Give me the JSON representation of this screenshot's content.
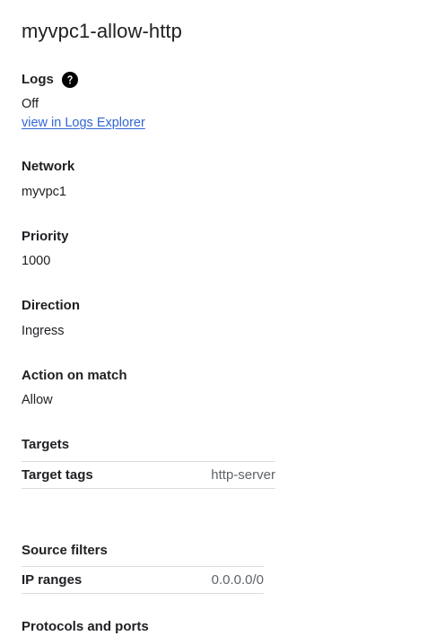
{
  "page": {
    "title": "myvpc1-allow-http"
  },
  "logs": {
    "label": "Logs",
    "help_icon": "help-circle-icon",
    "value": "Off",
    "link_text": "view in Logs Explorer"
  },
  "network": {
    "label": "Network",
    "value": "myvpc1"
  },
  "priority": {
    "label": "Priority",
    "value": "1000"
  },
  "direction": {
    "label": "Direction",
    "value": "Ingress"
  },
  "action": {
    "label": "Action on match",
    "value": "Allow"
  },
  "targets": {
    "label": "Targets",
    "rows": [
      {
        "key": "Target tags",
        "value": "http-server"
      }
    ]
  },
  "source_filters": {
    "label": "Source filters",
    "rows": [
      {
        "key": "IP ranges",
        "value": "0.0.0.0/0"
      }
    ]
  },
  "protocols": {
    "label": "Protocols and ports"
  },
  "colors": {
    "text": "#202124",
    "link": "#3367d6",
    "muted": "#5f6368",
    "divider": "#dadce0"
  }
}
